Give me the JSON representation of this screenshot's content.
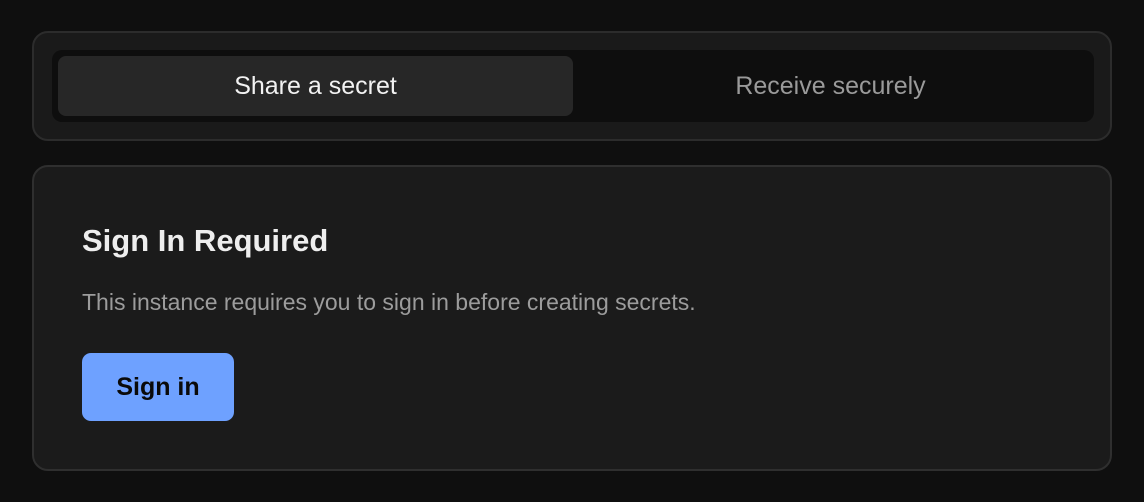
{
  "tabs": [
    {
      "label": "Share a secret",
      "active": true
    },
    {
      "label": "Receive securely",
      "active": false
    }
  ],
  "notice": {
    "title": "Sign In Required",
    "description": "This instance requires you to sign in before creating secrets.",
    "button_label": "Sign in"
  },
  "colors": {
    "background": "#0f0f0f",
    "card": "#1b1b1b",
    "accent": "#6ea1ff",
    "active_tab": "#272727"
  }
}
